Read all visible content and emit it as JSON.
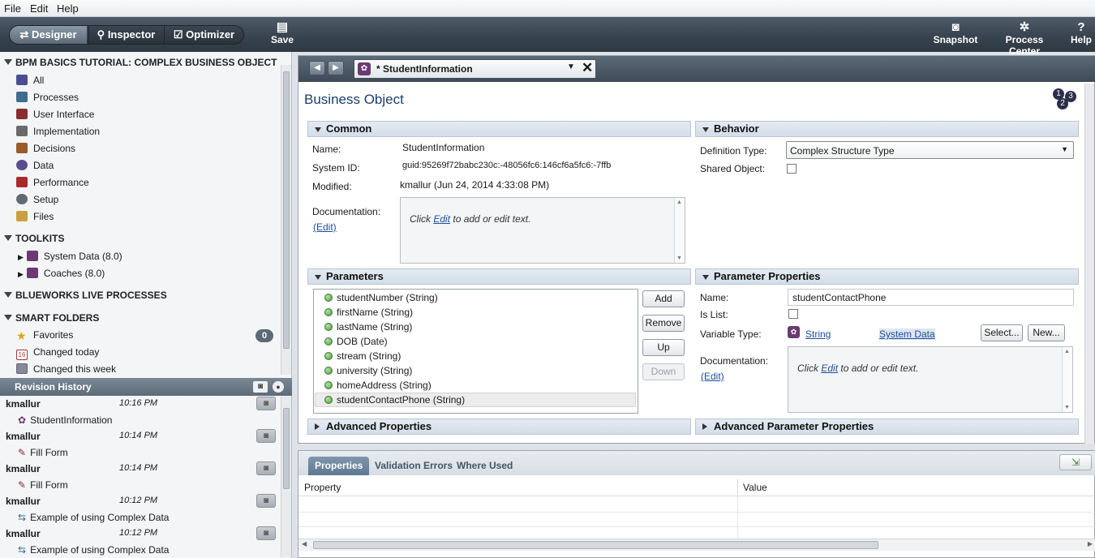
{
  "menu": [
    "File",
    "Edit",
    "Help"
  ],
  "toolbar": {
    "designer": "Designer",
    "inspector": "Inspector",
    "optimizer": "Optimizer",
    "save": "Save",
    "snapshot": "Snapshot",
    "process_center": "Process Center",
    "help": "Help"
  },
  "library": {
    "project_title": "BPM BASICS TUTORIAL: COMPLEX BUSINESS OBJECT",
    "items": [
      "All",
      "Processes",
      "User Interface",
      "Implementation",
      "Decisions",
      "Data",
      "Performance",
      "Setup",
      "Files"
    ],
    "toolkits_title": "TOOLKITS",
    "toolkits": [
      "System Data (8.0)",
      "Coaches (8.0)"
    ],
    "blueworks_title": "BLUEWORKS LIVE PROCESSES",
    "smart_title": "SMART FOLDERS",
    "smart": [
      "Favorites",
      "Changed today",
      "Changed this week"
    ],
    "favorites_count": "0"
  },
  "revision": {
    "title": "Revision History",
    "entries": [
      {
        "user": "kmallur",
        "time": "10:16 PM",
        "item": "StudentInformation"
      },
      {
        "user": "kmallur",
        "time": "10:14 PM",
        "item": "Fill Form"
      },
      {
        "user": "kmallur",
        "time": "10:14 PM",
        "item": "Fill Form"
      },
      {
        "user": "kmallur",
        "time": "10:12 PM",
        "item": "Example of using Complex Data"
      },
      {
        "user": "kmallur",
        "time": "10:12 PM",
        "item": "Example of using Complex Data"
      }
    ]
  },
  "editor": {
    "tab_title": "* StudentInformation",
    "heading": "Business Object",
    "common": {
      "title": "Common",
      "name_label": "Name:",
      "name": "StudentInformation",
      "sysid_label": "System ID:",
      "sysid": "guid:95269f72babc230c:-48056fc6:146cf6a5fc6:-7ffb",
      "modified_label": "Modified:",
      "modified": "kmallur (Jun 24, 2014 4:33:08 PM)",
      "doc_label": "Documentation:",
      "doc_edit": "(Edit)",
      "doc_pre": "Click ",
      "doc_link": "Edit",
      "doc_post": " to add or edit text."
    },
    "behavior": {
      "title": "Behavior",
      "deftype_label": "Definition Type:",
      "deftype": "Complex Structure Type",
      "shared_label": "Shared Object:"
    },
    "parameters": {
      "title": "Parameters",
      "items": [
        "studentNumber (String)",
        "firstName (String)",
        "lastName (String)",
        "DOB (Date)",
        "stream (String)",
        "university (String)",
        "homeAddress (String)",
        "studentContactPhone (String)"
      ],
      "add": "Add",
      "remove": "Remove",
      "up": "Up",
      "down": "Down"
    },
    "param_props": {
      "title": "Parameter Properties",
      "name_label": "Name:",
      "name": "studentContactPhone",
      "islist_label": "Is List:",
      "vartype_label": "Variable Type:",
      "vartype": "String",
      "vartype_src": "System Data",
      "select": "Select...",
      "new": "New...",
      "doc_label": "Documentation:",
      "doc_edit": "(Edit)",
      "doc_pre": "Click ",
      "doc_link": "Edit",
      "doc_post": " to add or edit text."
    },
    "advanced": "Advanced Properties",
    "advanced_param": "Advanced Parameter Properties"
  },
  "bottom": {
    "tabs": [
      "Properties",
      "Validation Errors",
      "Where Used"
    ],
    "col_property": "Property",
    "col_value": "Value"
  }
}
